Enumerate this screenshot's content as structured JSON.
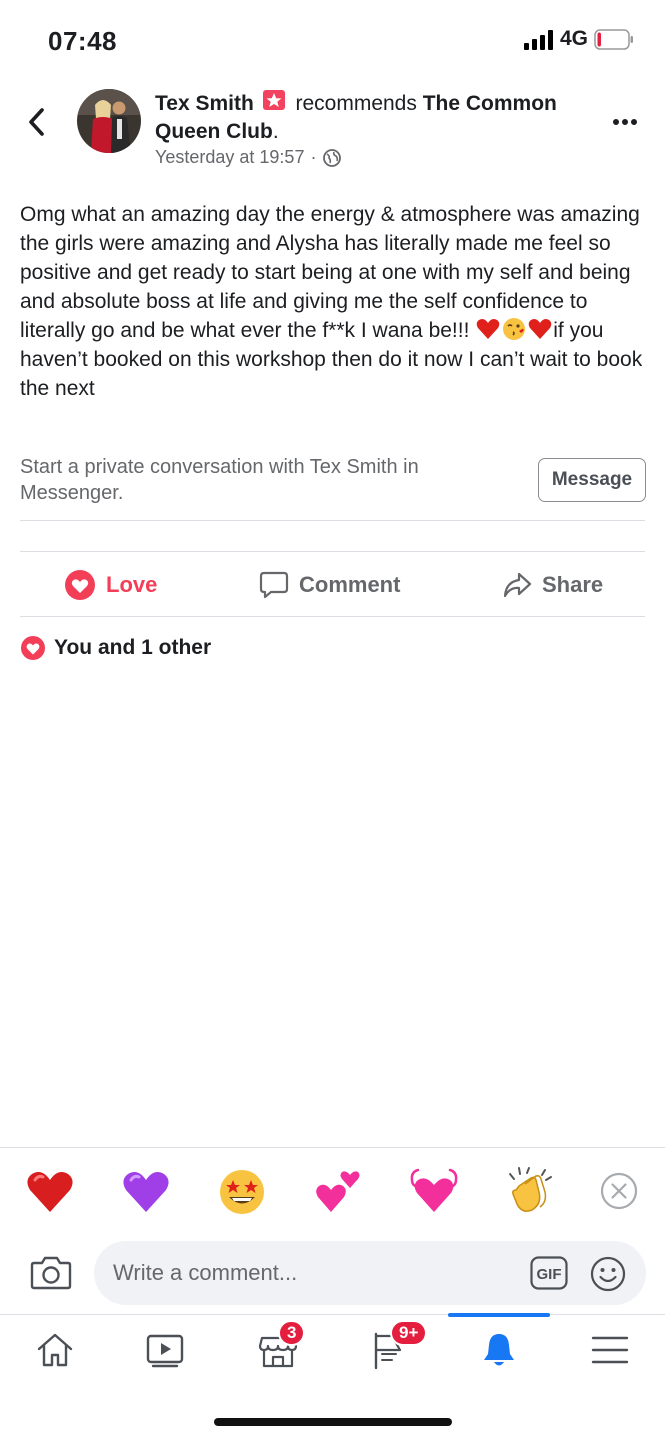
{
  "status_bar": {
    "time": "07:48",
    "network": "4G",
    "battery_level": 0.12,
    "battery_color": "#e41e3f"
  },
  "post": {
    "author": "Tex Smith",
    "action_text": "recommends",
    "page_name": "The Common Queen Club",
    "after_page": ".",
    "timestamp": "Yesterday at 19:57",
    "separator": "·",
    "privacy_icon": "globe-icon",
    "body_line1": "Omg what an amazing day the energy & atmosphere was amazing the girls were amazing and Alysha has literally made me feel so positive and get ready to start being at one with my self and being and absolute boss at life and giving me the self confidence to literally go and be what ever the f**k I wana be!!!  ",
    "body_line2": "if you haven’t booked on this workshop then do it now I can’t wait to book the next",
    "emojis": [
      "heart-emoji",
      "kissing-face-emoji",
      "heart-emoji"
    ]
  },
  "messenger_prompt": {
    "text": "Start a private conversation with Tex Smith in Messenger.",
    "button": "Message"
  },
  "actions": {
    "love": "Love",
    "comment": "Comment",
    "share": "Share",
    "love_color": "#f33e58"
  },
  "reactions_summary": "You and 1 other",
  "quick_reactions": [
    "red-heart",
    "purple-heart",
    "star-struck",
    "two-hearts",
    "growing-heart",
    "clapping-hands"
  ],
  "composer": {
    "placeholder": "Write a comment...",
    "gif_label": "GIF"
  },
  "tab_bar": {
    "marketplace_badge": "3",
    "pages_badge": "9+",
    "active_tab": "notifications",
    "accent": "#1877f2"
  }
}
